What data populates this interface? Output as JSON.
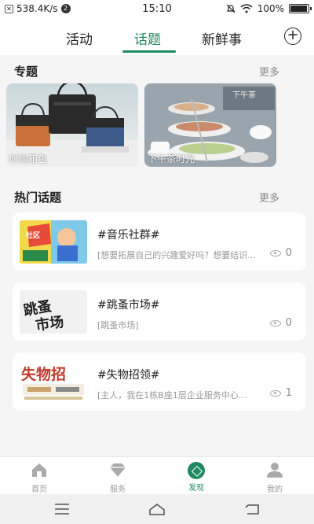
{
  "status_bar": {
    "speed": "538.4K/s",
    "notif_badge": "2",
    "time": "15:10",
    "battery": "100%",
    "battery_level": 1.0
  },
  "header": {
    "tabs": [
      {
        "label": "活动"
      },
      {
        "label": "话题"
      },
      {
        "label": "新鲜事"
      }
    ],
    "active_tab": "话题",
    "add_icon": "plus-circle-icon"
  },
  "topics": {
    "title": "专题",
    "more": "更多",
    "items": [
      {
        "label": "时尚箱包"
      },
      {
        "label": "下午茶时光"
      }
    ]
  },
  "hot": {
    "title": "热门话题",
    "more": "更多",
    "items": [
      {
        "title": "#音乐社群#",
        "desc": "[想要拓展自己的兴趣爱好吗？想要结识...",
        "views": "0"
      },
      {
        "title": "#跳蚤市场#",
        "desc": "[跳蚤市场]",
        "views": "0"
      },
      {
        "title": "#失物招领#",
        "desc": "[主人，我在1栋B座1层企业服务中心...",
        "views": "1"
      }
    ]
  },
  "bottom_nav": {
    "items": [
      {
        "label": "首页",
        "icon": "home-icon"
      },
      {
        "label": "服务",
        "icon": "diamond-icon"
      },
      {
        "label": "发现",
        "icon": "compass-icon"
      },
      {
        "label": "我的",
        "icon": "person-icon"
      }
    ],
    "active": "发现"
  },
  "colors": {
    "accent": "#1f8a5f"
  }
}
